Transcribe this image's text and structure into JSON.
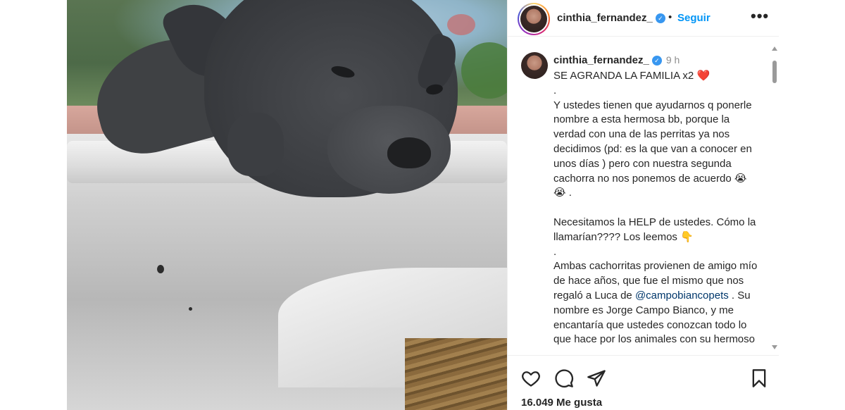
{
  "post": {
    "username": "cinthia_fernandez_",
    "follow_label": "Seguir",
    "more_label": "•••",
    "separator": "•",
    "time_ago": "9 h",
    "caption": {
      "line1": "SE AGRANDA LA FAMILIA x2",
      "dot1": ".",
      "para1": "Y ustedes tienen que ayudarnos q ponerle nombre a esta hermosa bb, porque la verdad con una de las perritas ya nos decidimos (pd: es la que van a conocer en unos días ) pero con nuestra segunda cachorra no nos ponemos de acuerdo",
      "para1_emoji": "😭😭",
      "para1_end": ".",
      "para2": "Necesitamos la HELP de ustedes. Cómo la llamarían???? Los leemos",
      "para2_emoji": "👇",
      "dot2": ".",
      "para3_a": "Ambas cachorritas provienen de amigo mío de hace años, que fue el mismo que nos regaló a Luca de",
      "mention": "@campobiancopets",
      "para3_b": ". Su nombre es Jorge Campo Bianco, y me encantaría que ustedes conozcan todo lo que hace por los animales con su hermoso"
    },
    "likes": "16.049 Me gusta"
  },
  "icons": {
    "verified": "verified-badge-icon",
    "like": "heart-icon",
    "comment": "comment-icon",
    "share": "share-icon",
    "save": "bookmark-icon"
  },
  "colors": {
    "accent": "#0095f6",
    "verified": "#3897f0",
    "text": "#262626",
    "muted": "#8e8e8e",
    "mention": "#00376b"
  }
}
